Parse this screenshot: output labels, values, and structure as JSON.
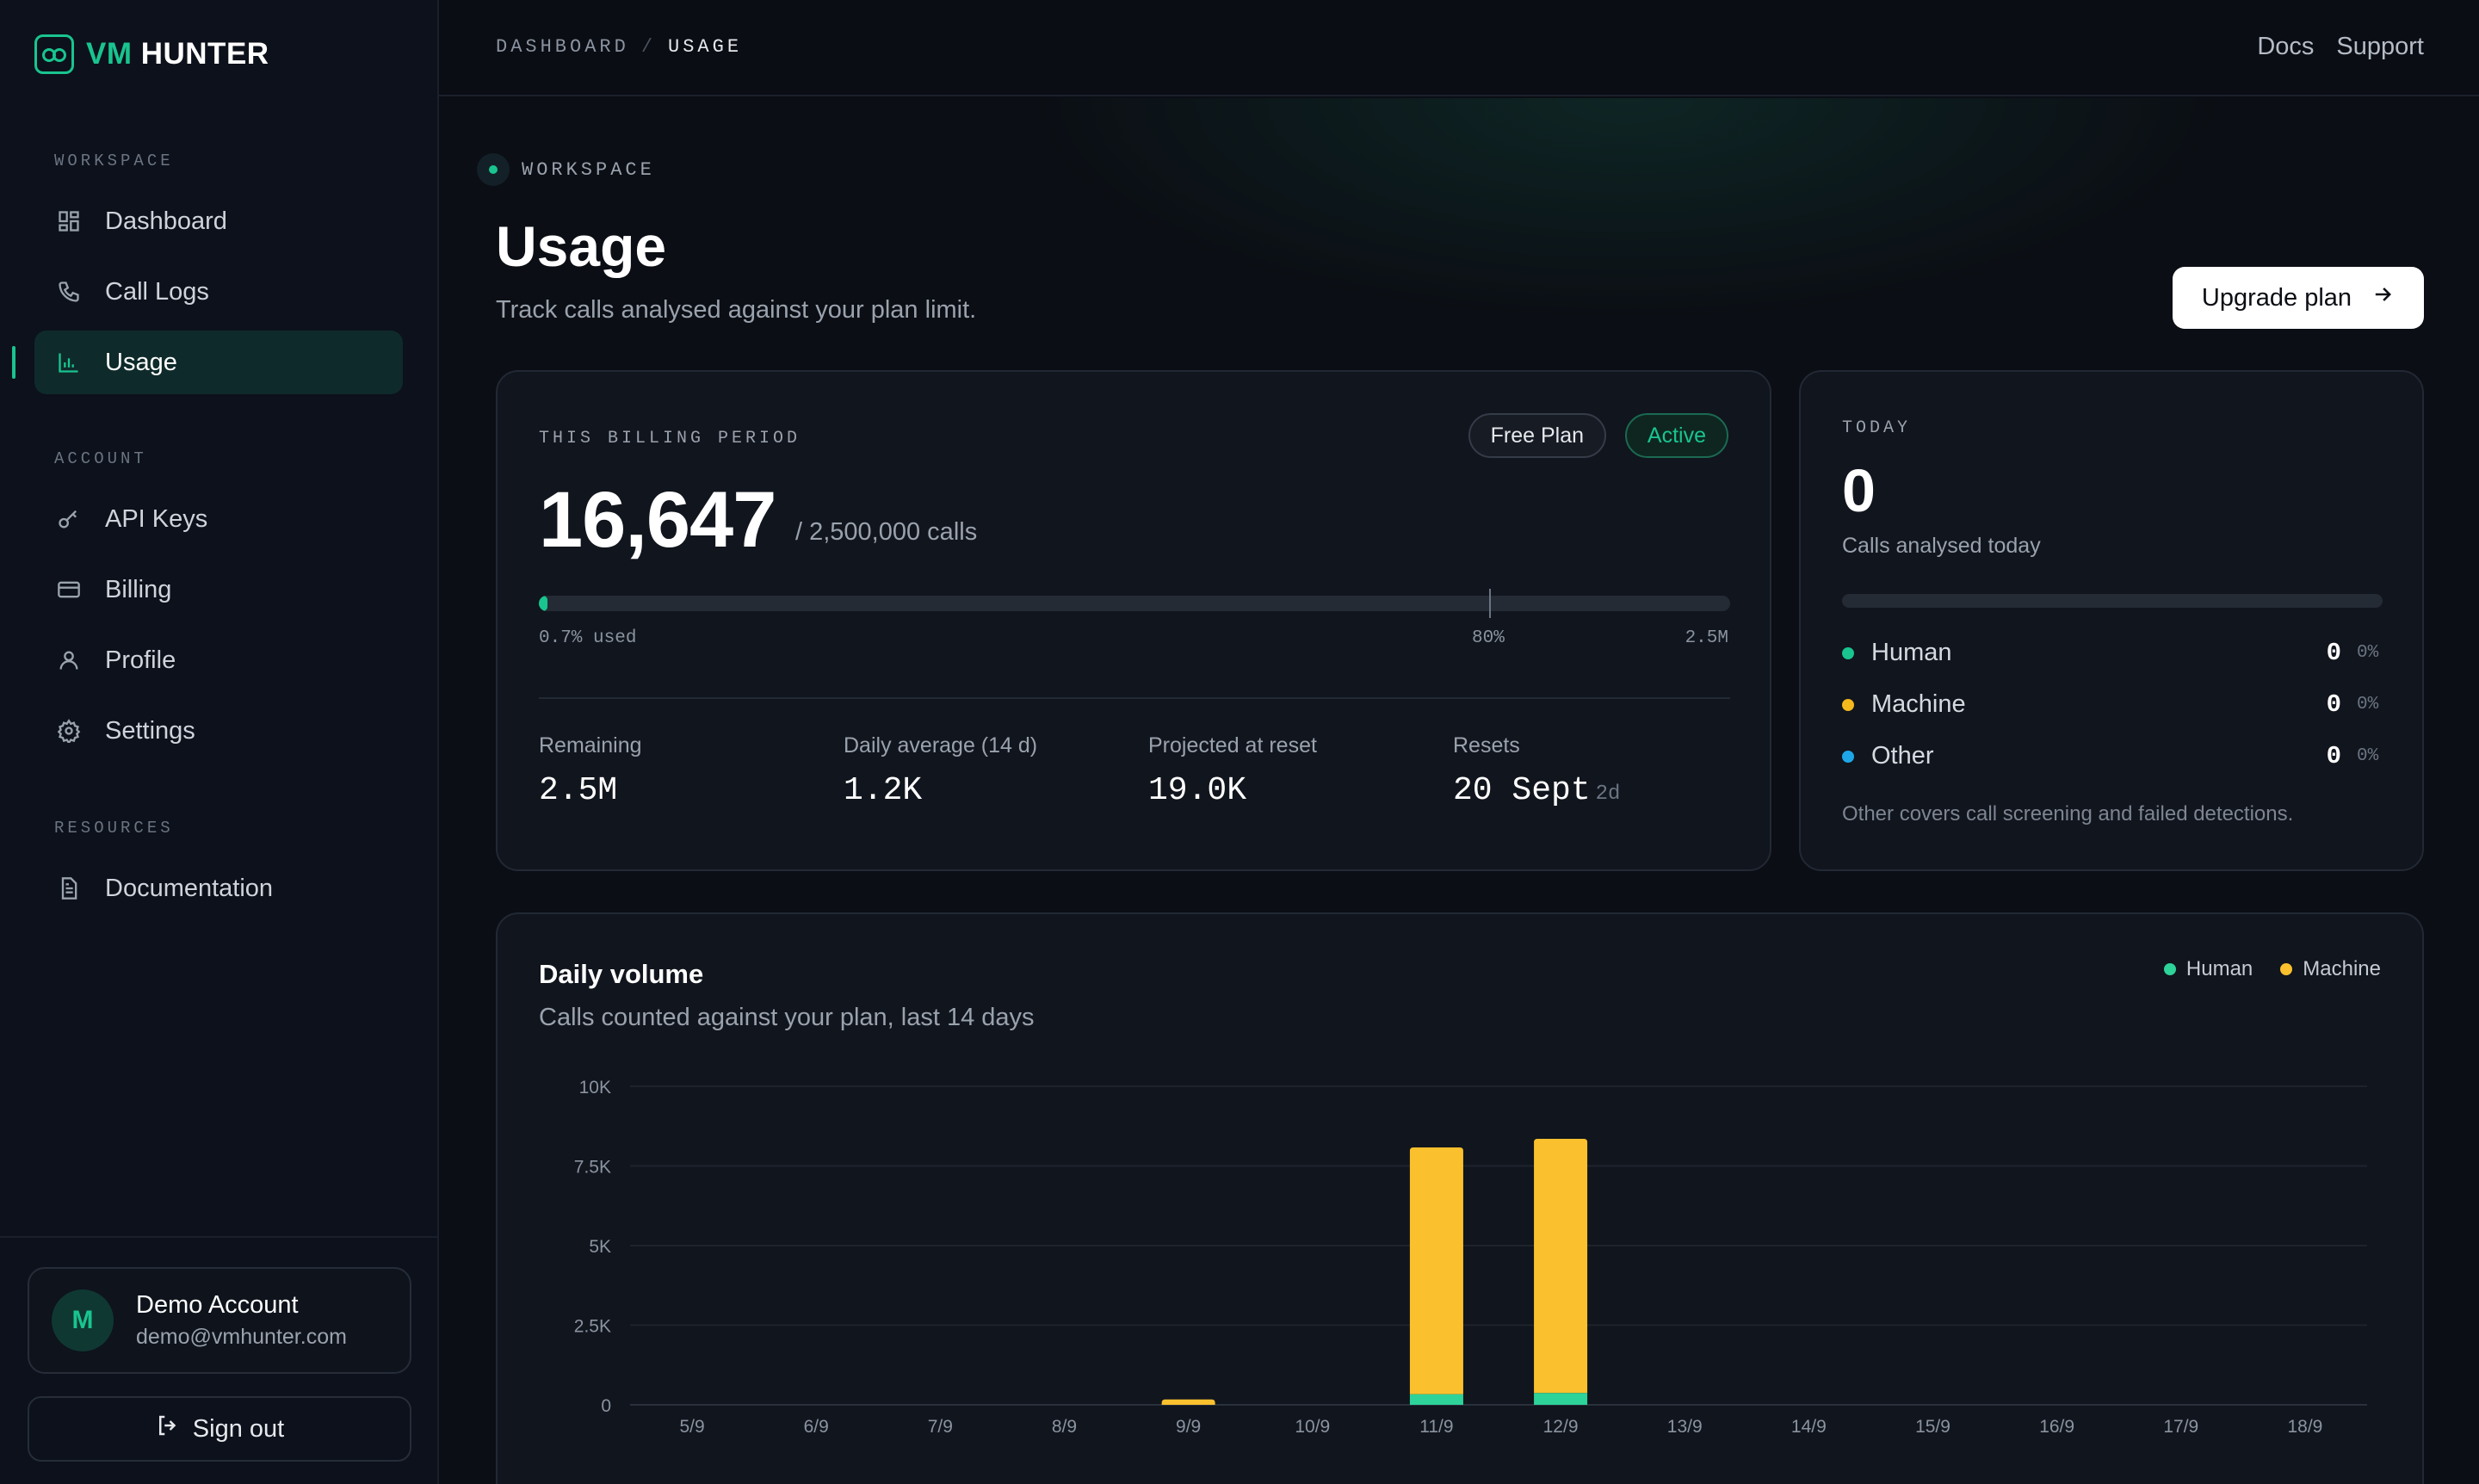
{
  "brand": {
    "vm": "VM",
    "hunter": "HUNTER"
  },
  "nav": {
    "workspace_heading": "WORKSPACE",
    "dashboard": "Dashboard",
    "call_logs": "Call Logs",
    "usage": "Usage",
    "account_heading": "ACCOUNT",
    "api_keys": "API Keys",
    "billing": "Billing",
    "profile": "Profile",
    "settings": "Settings",
    "resources_heading": "RESOURCES",
    "documentation": "Documentation"
  },
  "account": {
    "initial": "M",
    "name": "Demo Account",
    "email": "demo@vmhunter.com",
    "sign_out": "Sign out"
  },
  "topbar": {
    "crumb1": "DASHBOARD",
    "sep": "/",
    "crumb2": "USAGE",
    "docs": "Docs",
    "support": "Support"
  },
  "header": {
    "eyebrow": "WORKSPACE",
    "title": "Usage",
    "subtitle": "Track calls analysed against your plan limit.",
    "upgrade": "Upgrade plan"
  },
  "billing": {
    "label": "THIS BILLING PERIOD",
    "plan": "Free Plan",
    "status": "Active",
    "calls": "16,647",
    "limit": "/ 2,500,000 calls",
    "used_fraction": 0.007,
    "used_label": "0.7% used",
    "marker_label": "80%",
    "max_label": "2.5M",
    "stats": [
      {
        "k": "Remaining",
        "v": "2.5M",
        "extra": ""
      },
      {
        "k": "Daily average (14 d)",
        "v": "1.2K",
        "extra": ""
      },
      {
        "k": "Projected at reset",
        "v": "19.0K",
        "extra": ""
      },
      {
        "k": "Resets",
        "v": "20 Sept",
        "extra": "2d"
      }
    ]
  },
  "today": {
    "label": "TODAY",
    "count": "0",
    "sub": "Calls analysed today",
    "rows": [
      {
        "name": "Human",
        "n": "0",
        "p": "0%",
        "color": "#19c48f"
      },
      {
        "name": "Machine",
        "n": "0",
        "p": "0%",
        "color": "#f5b91e"
      },
      {
        "name": "Other",
        "n": "0",
        "p": "0%",
        "color": "#1ea7e8"
      }
    ],
    "note": "Other covers call screening and failed detections."
  },
  "volume": {
    "title": "Daily volume",
    "subtitle": "Calls counted against your plan, last 14 days"
  },
  "colors": {
    "accent": "#19c48f",
    "human": "#2ed39a",
    "machine": "#fbc02d"
  },
  "chart_data": {
    "type": "bar",
    "stacked": true,
    "categories": [
      "5/9",
      "6/9",
      "7/9",
      "8/9",
      "9/9",
      "10/9",
      "11/9",
      "12/9",
      "13/9",
      "14/9",
      "15/9",
      "16/9",
      "17/9",
      "18/9"
    ],
    "series": [
      {
        "name": "Human",
        "values": [
          0,
          0,
          0,
          0,
          0,
          0,
          330,
          370,
          0,
          0,
          0,
          0,
          0,
          0
        ]
      },
      {
        "name": "Machine",
        "values": [
          0,
          0,
          0,
          0,
          170,
          0,
          7750,
          7980,
          0,
          0,
          0,
          0,
          0,
          0
        ]
      }
    ],
    "y_ticks": [
      "0",
      "2.5K",
      "5K",
      "7.5K",
      "10K"
    ],
    "ylim": [
      0,
      10000
    ],
    "grid": true,
    "legend": "top-right"
  }
}
